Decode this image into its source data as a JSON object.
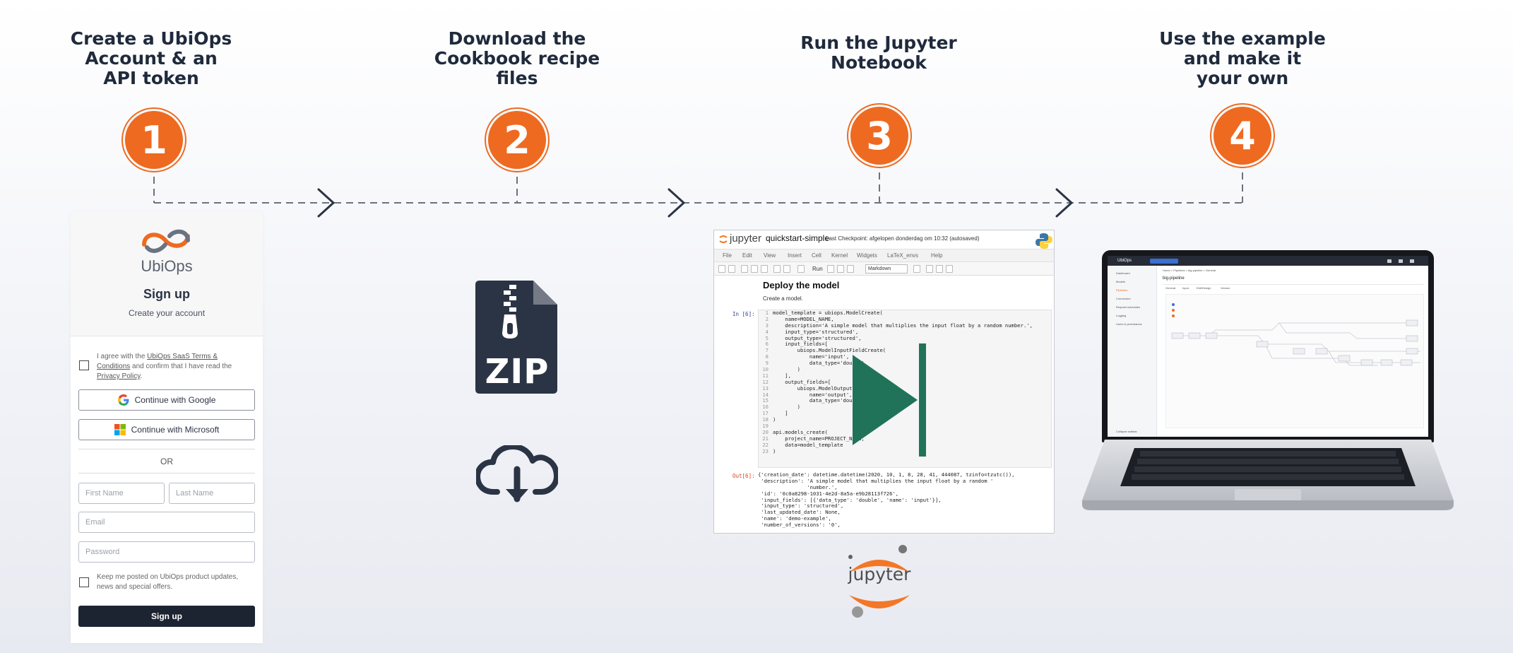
{
  "steps": [
    {
      "number": "1",
      "title_lines": [
        "Create a UbiOps",
        "Account & an",
        "API token"
      ]
    },
    {
      "number": "2",
      "title_lines": [
        "Download the",
        "Cookbook recipe",
        "files"
      ]
    },
    {
      "number": "3",
      "title_lines": [
        "Run the Jupyter",
        "Notebook"
      ]
    },
    {
      "number": "4",
      "title_lines": [
        "Use the example",
        "and make it",
        "your own"
      ]
    }
  ],
  "colors": {
    "accent": "#ee6a20",
    "dark": "#1f2a3c",
    "jupyter_green": "#207359",
    "connector": "#6b7280"
  },
  "signup": {
    "brand": "UbiOps",
    "title": "Sign up",
    "subtitle": "Create your account",
    "terms": {
      "prefix": "I agree with the ",
      "link1": "UbiOps SaaS Terms &",
      "link1b": "Conditions",
      "middle": " and confirm that I have read the",
      "link2": "Privacy Policy",
      "suffix": "."
    },
    "google_label": "Continue with Google",
    "microsoft_label": "Continue with Microsoft",
    "or_label": "OR",
    "first_name_placeholder": "First Name",
    "last_name_placeholder": "Last Name",
    "email_placeholder": "Email",
    "password_placeholder": "Password",
    "newsletter_line1": "Keep me posted on UbiOps product updates,",
    "newsletter_line2": "news and special offers.",
    "submit_label": "Sign up"
  },
  "download": {
    "zip_label": "ZIP",
    "icons": [
      "zip-file-icon",
      "cloud-download-icon"
    ]
  },
  "jupyter": {
    "logo_text": "jupyter",
    "notebook_name": "quickstart-simple",
    "checkpoint": "Last Checkpoint: afgelopen donderdag om 10:32   (autosaved)",
    "menu": [
      "File",
      "Edit",
      "View",
      "Insert",
      "Cell",
      "Kernel",
      "Widgets",
      "LaTeX_envs",
      "Help"
    ],
    "run_label": "Run",
    "cell_type": "Markdown",
    "heading": "Deploy the model",
    "text": "Create a model.",
    "in_prompt": "In [6]:",
    "out_prompt": "Out[6]:",
    "code_lines": [
      "model_template = ubiops.ModelCreate(",
      "    name=MODEL_NAME,",
      "    description='A simple model that multiplies the input float by a random number.',",
      "    input_type='structured',",
      "    output_type='structured',",
      "    input_fields=[",
      "        ubiops.ModelInputFieldCreate(",
      "            name='input',",
      "            data_type='double'",
      "        )",
      "    ],",
      "    output_fields=[",
      "        ubiops.ModelOutputFieldCreate(",
      "            name='output',",
      "            data_type='double'",
      "        )",
      "    ]",
      ")",
      "",
      "api.models_create(",
      "    project_name=PROJECT_NAME,",
      "    data=model_template",
      ")"
    ],
    "output_lines": [
      "{'creation_date': datetime.datetime(2020, 10, 1, 8, 28, 41, 444087, tzinfo=tzutc()),",
      " 'description': 'A simple model that multiplies the input float by a random '",
      "                'number.',",
      " 'id': '0c0a8298-1031-4e2d-8a5a-e9b28113f726',",
      " 'input_fields': [{'data_type': 'double', 'name': 'input'}],",
      " 'input_type': 'structured',",
      " 'last_updated_date': None,",
      " 'name': 'demo-example',",
      " 'number_of_versions': '0',"
    ],
    "brand_logo_text": "jupyter"
  },
  "laptop": {
    "app_name": "UbiOps",
    "nav_items": [
      "Dashboard",
      "Models",
      "Pipelines",
      "Connectors",
      "Request schedules",
      "Logging",
      "Users & permissions"
    ],
    "page_title": "big-pipeline",
    "breadcrumb": "Home > Pipelines > big-pipeline > General",
    "tabs": [
      "General",
      "Input",
      "Edit/Design",
      "Version"
    ],
    "collapse_label": "Collapse sidebar"
  }
}
